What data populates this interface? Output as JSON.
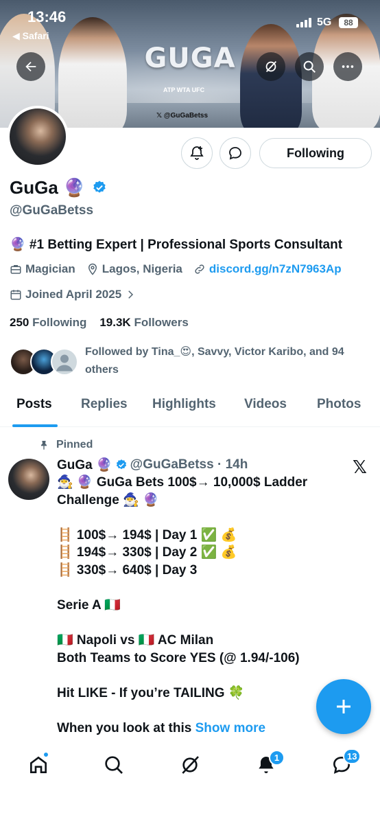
{
  "status_bar": {
    "time": "13:46",
    "back_app": "◀ Safari",
    "network": "5G",
    "battery": "88"
  },
  "banner": {
    "brand": "GUGA",
    "logos": "ATP WTA UFC",
    "handle_tag": "𝕏 @GuGaBetss"
  },
  "profile": {
    "name": "GuGa 🔮",
    "handle": "@GuGaBetss",
    "follow_label": "Following",
    "bio": "🔮 #1 Betting Expert | Professional Sports Consultant",
    "category": "Magician",
    "location": "Lagos, Nigeria",
    "link": "discord.gg/n7zN7963Ap",
    "joined": "Joined April 2025",
    "following_count": "250",
    "following_label": "Following",
    "followers_count": "19.3K",
    "followers_label": "Followers",
    "followed_by": "Followed by Tina_😍, Savvy, Victor Karibo, and 94 others"
  },
  "tabs": [
    "Posts",
    "Replies",
    "Highlights",
    "Videos",
    "Photos"
  ],
  "tweet": {
    "pinned_label": "Pinned",
    "author_name": "GuGa 🔮",
    "author_handle": "@GuGaBetss · 14h",
    "lines": [
      "🧙‍♂️ 🔮 GuGa Bets 100$→ 10,000$ Ladder",
      "Challenge 🧙‍♂️ 🔮",
      "",
      "🪜 100$→ 194$ | Day 1 ✅ 💰",
      "🪜 194$→ 330$ | Day 2 ✅ 💰",
      "🪜 330$→ 640$ | Day 3",
      "",
      "Serie A 🇮🇹",
      "",
      "🇮🇹 Napoli vs 🇮🇹 AC Milan",
      "Both Teams to Score YES (@ 1.94/-106)",
      "",
      "Hit LIKE - If you’re TAILING 🍀",
      ""
    ],
    "last_line": "When you look at this",
    "show_more": "Show more"
  },
  "nav": {
    "notifications_badge": "1",
    "messages_badge": "13"
  },
  "colors": {
    "accent": "#1d9bf0",
    "text": "#0f1419",
    "secondary": "#536471"
  }
}
